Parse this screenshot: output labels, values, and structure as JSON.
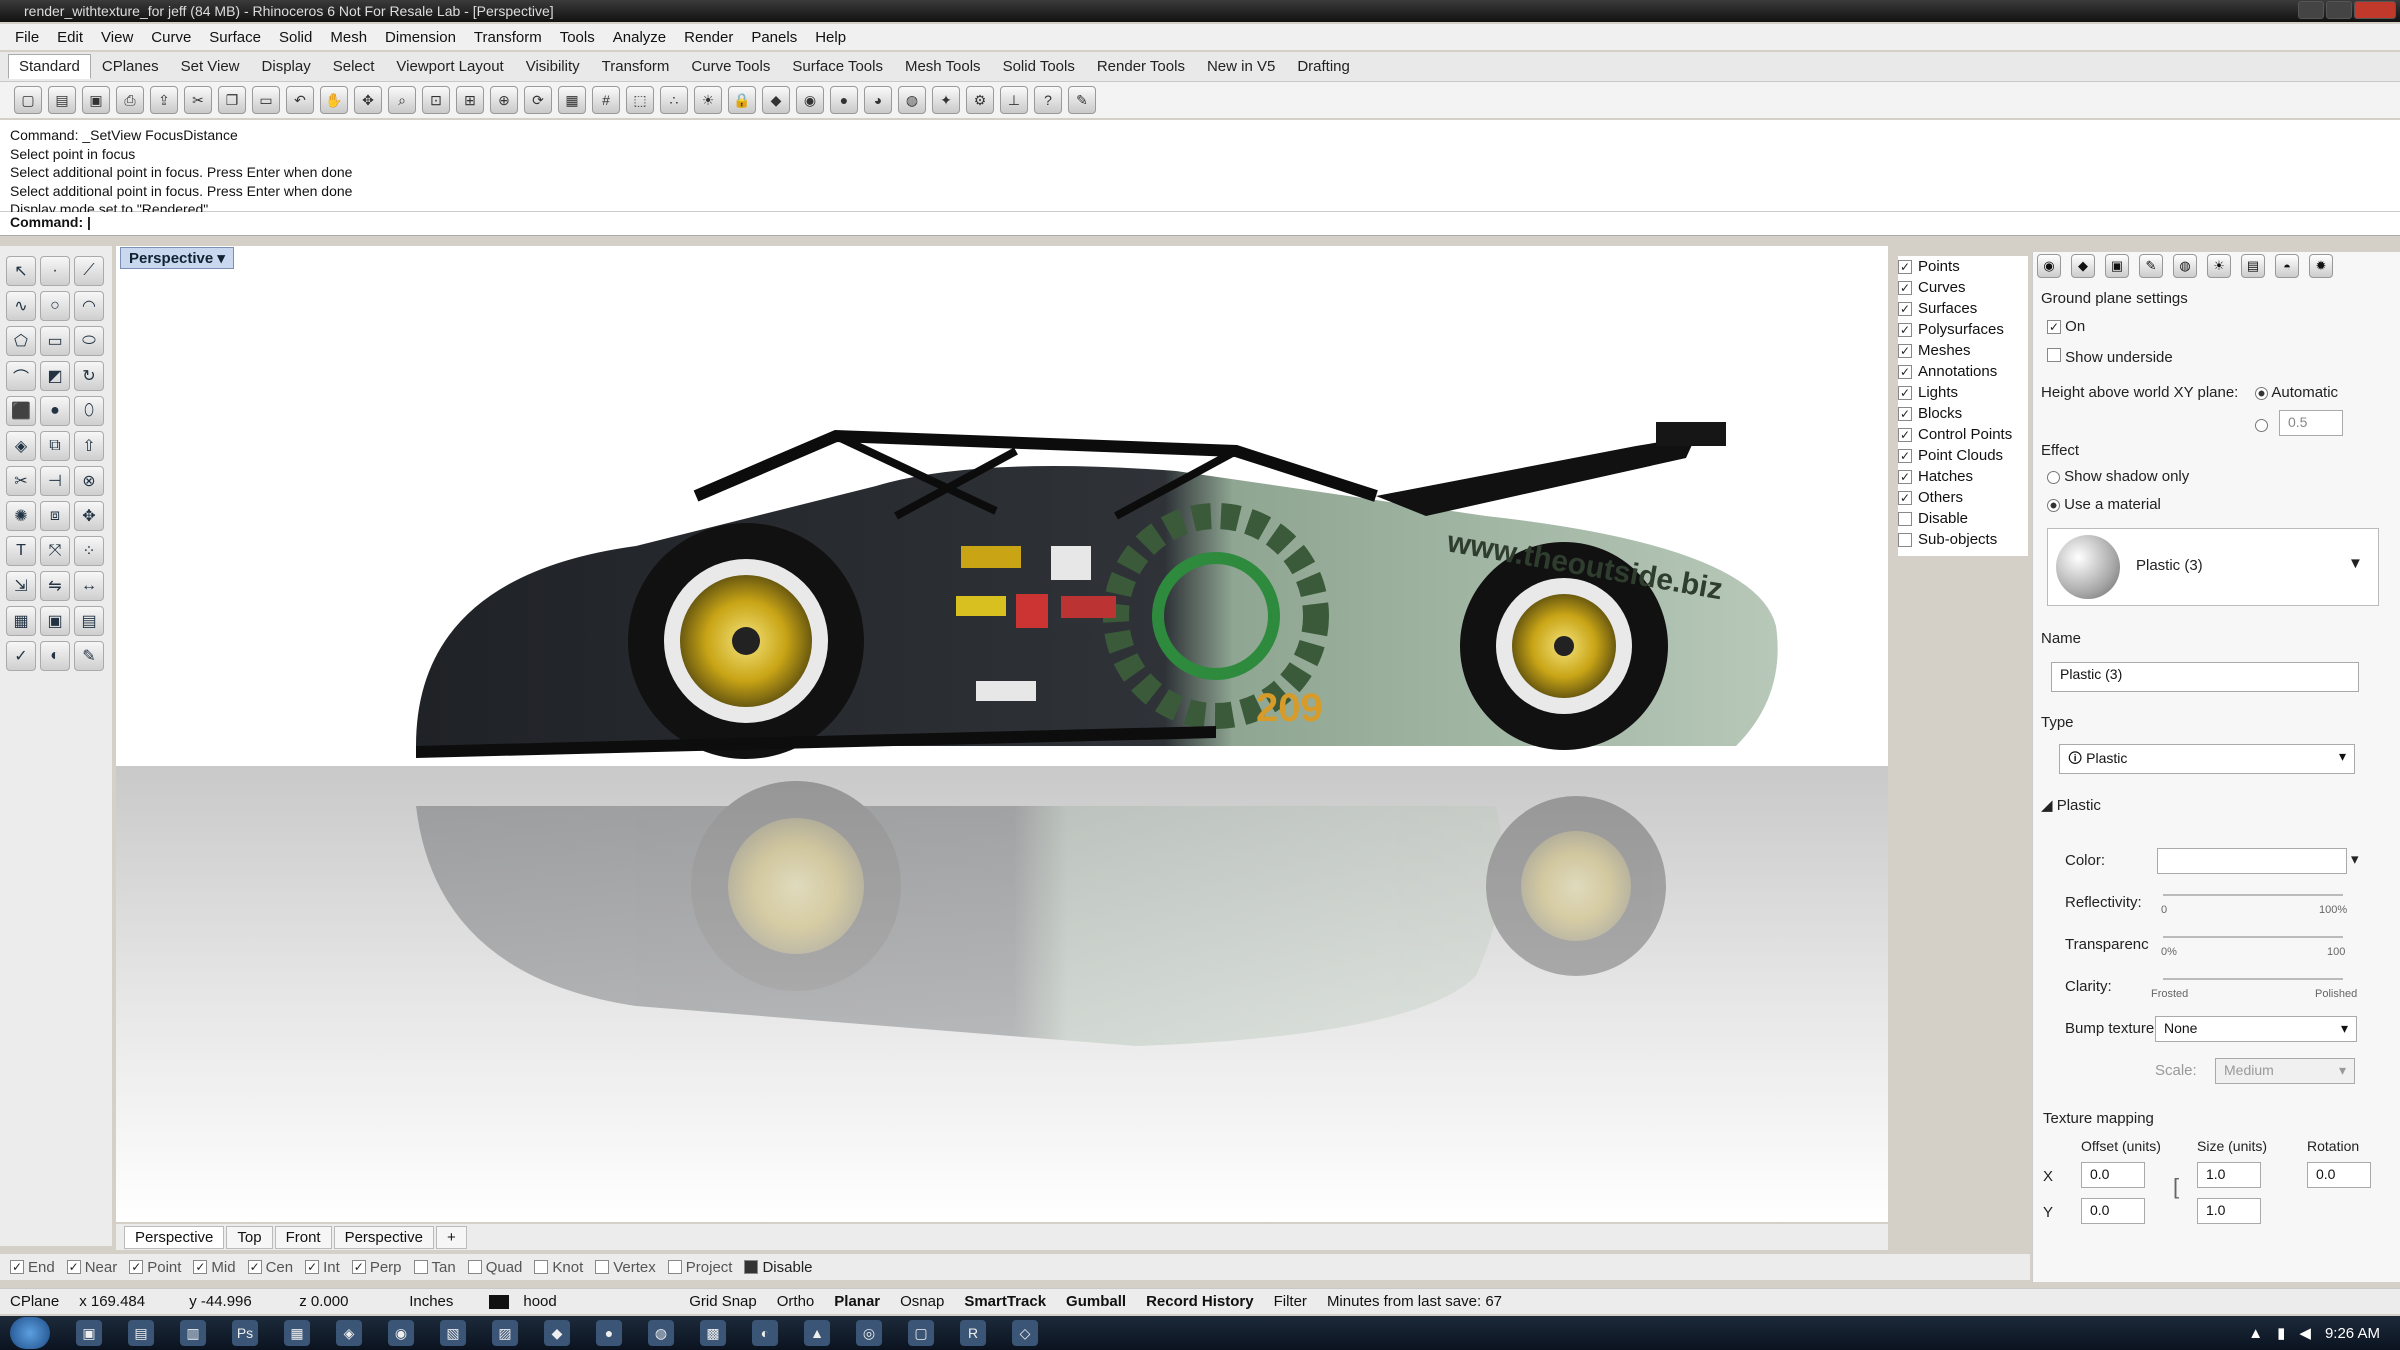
{
  "window": {
    "title": "render_withtexture_for jeff (84 MB) - Rhinoceros 6 Not For Resale Lab - [Perspective]"
  },
  "menu": [
    "File",
    "Edit",
    "View",
    "Curve",
    "Surface",
    "Solid",
    "Mesh",
    "Dimension",
    "Transform",
    "Tools",
    "Analyze",
    "Render",
    "Panels",
    "Help"
  ],
  "toolbar_tabs": [
    "Standard",
    "CPlanes",
    "Set View",
    "Display",
    "Select",
    "Viewport Layout",
    "Visibility",
    "Transform",
    "Curve Tools",
    "Surface Tools",
    "Mesh Tools",
    "Solid Tools",
    "Render Tools",
    "New in V5",
    "Drafting"
  ],
  "command": {
    "history": [
      "Command: _SetView FocusDistance",
      "Select point in focus",
      "Select additional point in focus. Press Enter when done",
      "Select additional point in focus. Press Enter when done",
      "Display mode set to \"Rendered\"."
    ],
    "prompt": "Command:"
  },
  "viewport": {
    "label": "Perspective",
    "tabs": [
      "Perspective",
      "Top",
      "Front",
      "Perspective",
      "+"
    ],
    "decal_url": "www.theoutside.biz",
    "car_number": "209"
  },
  "layers": [
    {
      "label": "Points",
      "checked": true
    },
    {
      "label": "Curves",
      "checked": true
    },
    {
      "label": "Surfaces",
      "checked": true
    },
    {
      "label": "Polysurfaces",
      "checked": true
    },
    {
      "label": "Meshes",
      "checked": true
    },
    {
      "label": "Annotations",
      "checked": true
    },
    {
      "label": "Lights",
      "checked": true
    },
    {
      "label": "Blocks",
      "checked": true
    },
    {
      "label": "Control Points",
      "checked": true
    },
    {
      "label": "Point Clouds",
      "checked": true
    },
    {
      "label": "Hatches",
      "checked": true
    },
    {
      "label": "Others",
      "checked": true
    },
    {
      "label": "Disable",
      "checked": false
    },
    {
      "label": "Sub-objects",
      "checked": false
    }
  ],
  "ground_plane": {
    "section_title": "Ground plane settings",
    "on_label": "On",
    "show_underside_label": "Show underside",
    "height_label": "Height above world XY plane:",
    "automatic_label": "Automatic",
    "height_value": "0.5",
    "effect_label": "Effect",
    "shadow_only_label": "Show shadow only",
    "use_material_label": "Use a material",
    "material_preview_name": "Plastic (3)",
    "name_label": "Name",
    "name_value": "Plastic (3)",
    "type_label": "Type",
    "type_value": "Plastic",
    "plastic_label": "Plastic",
    "color_label": "Color:",
    "reflectivity_label": "Reflectivity:",
    "refl_min": "0",
    "refl_max": "100%",
    "transparency_label": "Transparenc",
    "trans_min": "0%",
    "trans_max": "100",
    "clarity_label": "Clarity:",
    "clarity_min": "Frosted",
    "clarity_max": "Polished",
    "bump_label": "Bump texture",
    "bump_value": "None",
    "scale_label": "Scale:",
    "scale_value": "Medium",
    "texture_mapping_label": "Texture mapping",
    "offset_label": "Offset (units)",
    "size_label": "Size (units)",
    "rotation_label": "Rotation",
    "x_label": "X",
    "y_label": "Y",
    "offset_x": "0.0",
    "offset_y": "0.0",
    "size_x": "1.0",
    "size_y": "1.0",
    "rotation": "0.0"
  },
  "osnap": [
    {
      "label": "End",
      "checked": true
    },
    {
      "label": "Near",
      "checked": true
    },
    {
      "label": "Point",
      "checked": true
    },
    {
      "label": "Mid",
      "checked": true
    },
    {
      "label": "Cen",
      "checked": true
    },
    {
      "label": "Int",
      "checked": true
    },
    {
      "label": "Perp",
      "checked": true
    },
    {
      "label": "Tan",
      "checked": false
    },
    {
      "label": "Quad",
      "checked": false
    },
    {
      "label": "Knot",
      "checked": false
    },
    {
      "label": "Vertex",
      "checked": false
    },
    {
      "label": "Project",
      "checked": false
    },
    {
      "label": "Disable",
      "checked": false
    }
  ],
  "status": {
    "cplane": "CPlane",
    "x": "x 169.484",
    "y": "y -44.996",
    "z": "z 0.000",
    "units": "Inches",
    "layer": "hood",
    "grid_snap": "Grid Snap",
    "ortho": "Ortho",
    "planar": "Planar",
    "osnap": "Osnap",
    "smarttrack": "SmartTrack",
    "gumball": "Gumball",
    "record_history": "Record History",
    "filter": "Filter",
    "autosave": "Minutes from last save: 67"
  },
  "taskbar": {
    "time": "9:26 AM"
  },
  "colors": {
    "accent": "#c9d7ef",
    "viewport_bg": "#ffffff",
    "car_dark": "#23262b",
    "car_green": "#9db39e",
    "rim_gold": "#d4b628"
  }
}
